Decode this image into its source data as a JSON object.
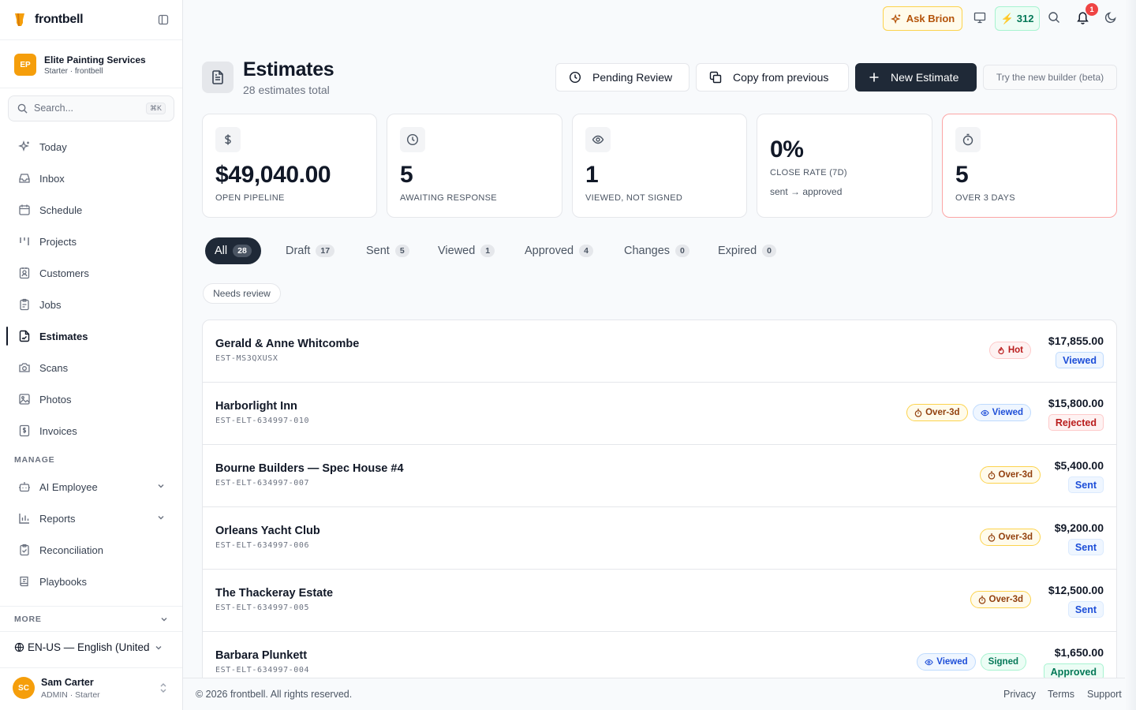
{
  "brand": {
    "name": "frontbell",
    "accent": "#f59e0b"
  },
  "org": {
    "initials": "EP",
    "name": "Elite Painting Services",
    "plan": "Starter · frontbell"
  },
  "search": {
    "placeholder": "Search...",
    "shortcut": "⌘K"
  },
  "nav": {
    "items": [
      {
        "label": "Today",
        "icon": "sparkle-icon"
      },
      {
        "label": "Inbox",
        "icon": "inbox-icon"
      },
      {
        "label": "Schedule",
        "icon": "calendar-icon"
      },
      {
        "label": "Projects",
        "icon": "kanban-icon"
      },
      {
        "label": "Customers",
        "icon": "contact-icon"
      },
      {
        "label": "Jobs",
        "icon": "clipboard-icon"
      },
      {
        "label": "Estimates",
        "icon": "file-signature-icon",
        "active": true
      },
      {
        "label": "Scans",
        "icon": "camera-icon"
      },
      {
        "label": "Photos",
        "icon": "image-icon"
      },
      {
        "label": "Invoices",
        "icon": "receipt-icon"
      }
    ],
    "manage_label": "MANAGE",
    "manage_items": [
      {
        "label": "AI Employee",
        "icon": "bot-icon"
      },
      {
        "label": "Reports",
        "icon": "chart-icon"
      },
      {
        "label": "Reconciliation",
        "icon": "clipboard-check-icon"
      },
      {
        "label": "Playbooks",
        "icon": "book-icon"
      }
    ],
    "more_label": "MORE",
    "language": "EN-US — English (United"
  },
  "user": {
    "initials": "SC",
    "name": "Sam Carter",
    "role": "ADMIN · Starter"
  },
  "topbar": {
    "ask_label": "Ask Brion",
    "credits": "312",
    "notifications": "1"
  },
  "header": {
    "title": "Estimates",
    "subtitle": "28 estimates total",
    "pending_label": "Pending Review",
    "copy_label": "Copy from previous",
    "new_label": "New Estimate",
    "beta_label": "Try the new builder (beta)"
  },
  "stats": [
    {
      "value": "$49,040.00",
      "caption": "OPEN PIPELINE",
      "icon": "dollar-icon"
    },
    {
      "value": "5",
      "caption": "AWAITING RESPONSE",
      "icon": "clock-icon"
    },
    {
      "value": "1",
      "caption": "VIEWED, NOT SIGNED",
      "icon": "eye-icon"
    },
    {
      "value": "0%",
      "caption": "CLOSE RATE (7D)",
      "note": "sent → approved"
    },
    {
      "value": "5",
      "caption": "OVER 3 DAYS",
      "icon": "timer-icon",
      "alert": true
    }
  ],
  "filters": [
    {
      "label": "All",
      "count": "28",
      "active": true
    },
    {
      "label": "Draft",
      "count": "17"
    },
    {
      "label": "Sent",
      "count": "5"
    },
    {
      "label": "Viewed",
      "count": "1"
    },
    {
      "label": "Approved",
      "count": "4"
    },
    {
      "label": "Changes",
      "count": "0"
    },
    {
      "label": "Expired",
      "count": "0"
    }
  ],
  "needs_review_label": "Needs review",
  "estimates": [
    {
      "name": "Gerald & Anne Whitcombe",
      "code": "EST-MS3QXUSX",
      "amount": "$17,855.00",
      "status": "Viewed",
      "tags": [
        {
          "label": "Hot",
          "kind": "hot"
        }
      ]
    },
    {
      "name": "Harborlight Inn",
      "code": "EST-ELT-634997-010",
      "amount": "$15,800.00",
      "status": "Rejected",
      "tags": [
        {
          "label": "Over-3d",
          "kind": "over"
        },
        {
          "label": "Viewed",
          "kind": "viewed"
        }
      ]
    },
    {
      "name": "Bourne Builders — Spec House #4",
      "code": "EST-ELT-634997-007",
      "amount": "$5,400.00",
      "status": "Sent",
      "tags": [
        {
          "label": "Over-3d",
          "kind": "over"
        }
      ]
    },
    {
      "name": "Orleans Yacht Club",
      "code": "EST-ELT-634997-006",
      "amount": "$9,200.00",
      "status": "Sent",
      "tags": [
        {
          "label": "Over-3d",
          "kind": "over"
        }
      ]
    },
    {
      "name": "The Thackeray Estate",
      "code": "EST-ELT-634997-005",
      "amount": "$12,500.00",
      "status": "Sent",
      "tags": [
        {
          "label": "Over-3d",
          "kind": "over"
        }
      ]
    },
    {
      "name": "Barbara Plunkett",
      "code": "EST-ELT-634997-004",
      "amount": "$1,650.00",
      "status": "Approved",
      "tags": [
        {
          "label": "Viewed",
          "kind": "viewed"
        },
        {
          "label": "Signed",
          "kind": "signed"
        }
      ]
    }
  ],
  "footer": {
    "copyright": "© 2026 frontbell. All rights reserved.",
    "privacy": "Privacy",
    "terms": "Terms",
    "support": "Support"
  }
}
